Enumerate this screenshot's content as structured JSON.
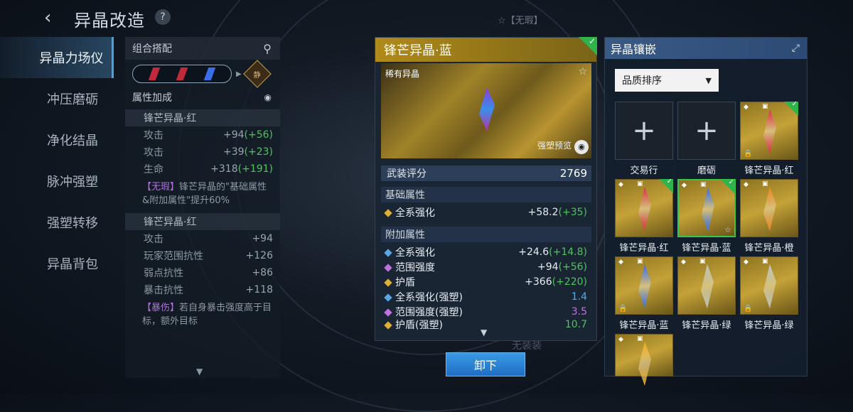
{
  "header": {
    "title": "异晶改造",
    "back_icon": "‹",
    "help": "?"
  },
  "top_hint": "☆【无瑕】",
  "ghost_hint": "无装装",
  "nav": {
    "items": [
      {
        "label": "异晶力场仪",
        "active": true
      },
      {
        "label": "冲压磨砺"
      },
      {
        "label": "净化结晶"
      },
      {
        "label": "脉冲强塑"
      },
      {
        "label": "强塑转移"
      },
      {
        "label": "异晶背包"
      }
    ]
  },
  "attr_panel": {
    "combo_title": "组合搭配",
    "badge": "静",
    "section_title": "属性加成",
    "group1": {
      "name": "锋芒异晶·红",
      "stats": [
        {
          "label": "攻击",
          "value": "+94",
          "bonus": "(+56)"
        },
        {
          "label": "攻击",
          "value": "+39",
          "bonus": "(+23)"
        },
        {
          "label": "生命",
          "value": "+318",
          "bonus": "(+191)"
        }
      ],
      "desc_tag": "【无瑕】",
      "desc_text": "锋芒异晶的\"基础属性&附加属性\"提升60%"
    },
    "group2": {
      "name": "锋芒异晶·红",
      "stats": [
        {
          "label": "攻击",
          "value": "+94"
        },
        {
          "label": "玩家范围抗性",
          "value": "+126"
        },
        {
          "label": "弱点抗性",
          "value": "+86"
        },
        {
          "label": "暴击抗性",
          "value": "+118"
        }
      ],
      "desc_tag": "【暴伤】",
      "desc_text": "若自身暴击强度高于目标，额外目标"
    }
  },
  "card": {
    "title": "锋芒异晶·蓝",
    "rarity": "稀有异晶",
    "preview_label": "强塑预览",
    "score_label": "武装评分",
    "score": "2769",
    "base_title": "基础属性",
    "base_stats": [
      {
        "label": "全系强化",
        "value": "+58.2",
        "bonus": "(+35)"
      }
    ],
    "extra_title": "附加属性",
    "extra_stats": [
      {
        "label": "全系强化",
        "value": "+24.6",
        "bonus": "(+14.8)",
        "color": "#58a8e8"
      },
      {
        "label": "范围强度",
        "value": "+94",
        "bonus": "(+56)",
        "color": "#c070e0"
      },
      {
        "label": "护盾",
        "value": "+366",
        "bonus": "(+220)",
        "color": "#e0b030"
      },
      {
        "label": "全系强化(强塑)",
        "value": "1.4",
        "color": "#58a8e8",
        "vclass": "blue"
      },
      {
        "label": "范围强度(强塑)",
        "value": "3.5",
        "color": "#c070e0",
        "vclass": "purple"
      },
      {
        "label": "护盾(强塑)",
        "value": "10.7",
        "color": "#e0b030",
        "vclass": "green"
      }
    ]
  },
  "unequip_label": "卸下",
  "inlay": {
    "title": "异晶镶嵌",
    "sort_label": "品质排序",
    "slots": [
      {
        "label": "交易行",
        "kind": "empty"
      },
      {
        "label": "磨砺",
        "kind": "empty"
      },
      {
        "label": "锋芒异晶·红",
        "kind": "gem",
        "gem": "#e03048",
        "check": true,
        "lock": true
      },
      {
        "label": "锋芒异晶·红",
        "kind": "gem",
        "gem": "#e03048",
        "check": true
      },
      {
        "label": "锋芒异晶·蓝",
        "kind": "gem",
        "gem": "#3a6ee8",
        "check": true,
        "selected": true,
        "star": true
      },
      {
        "label": "锋芒异晶·橙",
        "kind": "gem",
        "gem": "#f08a20"
      },
      {
        "label": "锋芒异晶·蓝",
        "kind": "gem",
        "gem": "#3a6ee8",
        "lock": true
      },
      {
        "label": "锋芒异晶·绿",
        "kind": "gem",
        "gem": "#c0c8c0"
      },
      {
        "label": "锋芒异晶·绿",
        "kind": "gem",
        "gem": "#c0c8c0",
        "lock": true
      },
      {
        "label": "",
        "kind": "gem",
        "gem": "#f0b020"
      }
    ]
  },
  "colors": {
    "accent": "#4aa0e0",
    "gold": "#b08a1a",
    "green": "#4fc35e"
  }
}
